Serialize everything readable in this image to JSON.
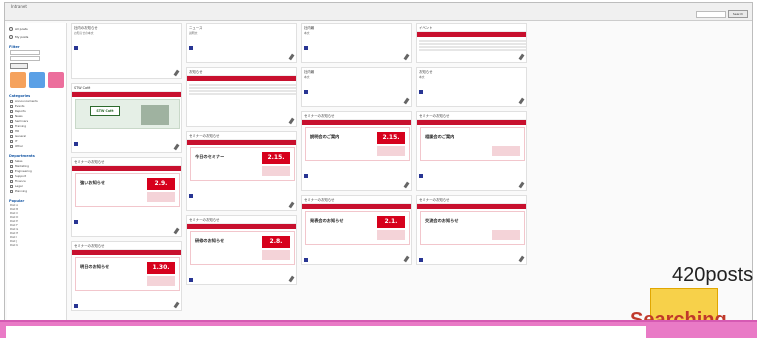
{
  "app": {
    "site_name": "Intranet"
  },
  "topbar": {
    "search_button": "Search"
  },
  "sidebar": {
    "radio_options": [
      "All posts",
      "My posts"
    ],
    "sections": [
      {
        "title": "Filter",
        "lines": [
          "Keyword",
          "Date",
          "Author"
        ]
      },
      {
        "title": "Categories",
        "lines": [
          "Announcements",
          "Events",
          "Reports",
          "News",
          "Seminars",
          "Training",
          "HR",
          "General",
          "IT",
          "Other"
        ]
      },
      {
        "title": "Departments",
        "lines": [
          "Sales",
          "Marketing",
          "Engineering",
          "Support",
          "Finance",
          "Legal",
          "Planning"
        ]
      },
      {
        "title": "Popular",
        "lines": [
          "Post A",
          "Post B",
          "Post C",
          "Post D",
          "Post E",
          "Post F",
          "Post G",
          "Post H",
          "Post I",
          "Post J",
          "Post K"
        ]
      }
    ]
  },
  "columns": [
    {
      "cards": [
        {
          "kind": "text",
          "title": "社内のお知らせ",
          "sub": "お知らせの本文"
        },
        {
          "kind": "stw",
          "title": "STW Café",
          "logo": "STW Café"
        },
        {
          "kind": "promo",
          "title": "セミナーのお知らせ",
          "promo": "強いお知らせ",
          "date": "2.9."
        },
        {
          "kind": "promo",
          "title": "セミナーのお知らせ",
          "promo": "明日のお知らせ",
          "date": "1.30."
        }
      ]
    },
    {
      "cards": [
        {
          "kind": "text",
          "title": "ニュース",
          "sub": "説明文"
        },
        {
          "kind": "banner",
          "title": "お知らせ"
        },
        {
          "kind": "promo",
          "title": "セミナーのお知らせ",
          "promo": "今日のセミナー",
          "date": "2.15."
        },
        {
          "kind": "promo",
          "title": "セミナーのお知らせ",
          "promo": "研修のお知らせ",
          "date": "2.8."
        }
      ]
    },
    {
      "cards": [
        {
          "kind": "text",
          "title": "社内報",
          "sub": "本文"
        },
        {
          "kind": "text",
          "title": "社内報",
          "sub": "本文"
        },
        {
          "kind": "promo",
          "title": "セミナーのお知らせ",
          "promo": "説明会のご案内",
          "date": "2.15."
        },
        {
          "kind": "promo",
          "title": "セミナーのお知らせ",
          "promo": "発表会のお知らせ",
          "date": "2.1."
        }
      ]
    },
    {
      "cards": [
        {
          "kind": "banner",
          "title": "イベント"
        },
        {
          "kind": "text",
          "title": "お知らせ",
          "sub": "本文"
        },
        {
          "kind": "promo",
          "title": "セミナーのお知らせ",
          "promo": "相談会のご案内",
          "date": ""
        },
        {
          "kind": "promo",
          "title": "セミナーのお知らせ",
          "promo": "交流会のお知らせ",
          "date": ""
        }
      ]
    }
  ],
  "overlay": {
    "posts": "420posts",
    "searching": "Searching"
  }
}
